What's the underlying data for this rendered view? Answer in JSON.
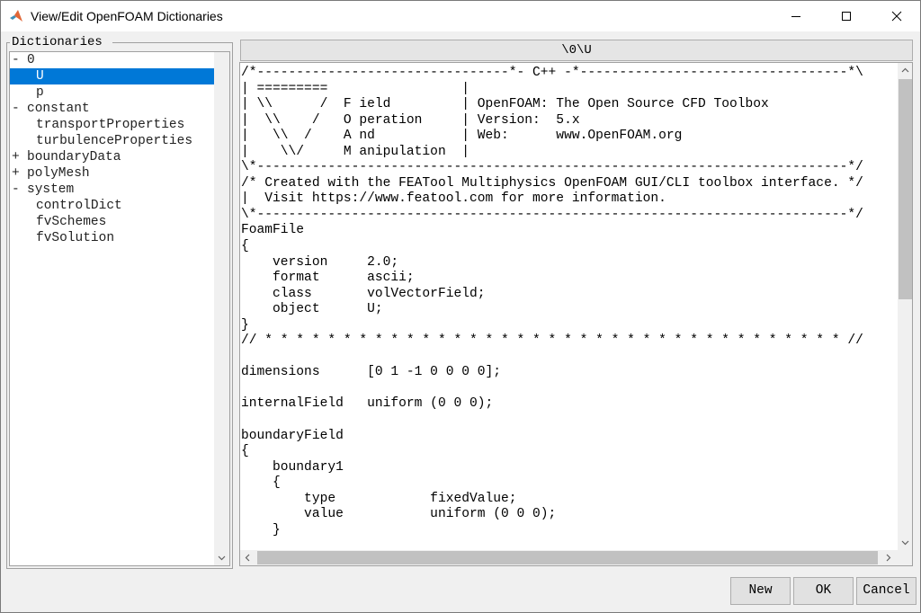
{
  "window": {
    "title": "View/Edit OpenFOAM Dictionaries"
  },
  "dictionaries": {
    "legend": "Dictionaries",
    "tree": [
      {
        "toggle": "-",
        "label": "0",
        "level": 0,
        "selected": false
      },
      {
        "toggle": "",
        "label": "U",
        "level": 1,
        "selected": true
      },
      {
        "toggle": "",
        "label": "p",
        "level": 1,
        "selected": false
      },
      {
        "toggle": "-",
        "label": "constant",
        "level": 0,
        "selected": false
      },
      {
        "toggle": "",
        "label": "transportProperties",
        "level": 1,
        "selected": false
      },
      {
        "toggle": "",
        "label": "turbulenceProperties",
        "level": 1,
        "selected": false
      },
      {
        "toggle": "+",
        "label": "boundaryData",
        "level": 0,
        "selected": false
      },
      {
        "toggle": "+",
        "label": "polyMesh",
        "level": 0,
        "selected": false
      },
      {
        "toggle": "-",
        "label": "system",
        "level": 0,
        "selected": false
      },
      {
        "toggle": "",
        "label": "controlDict",
        "level": 1,
        "selected": false
      },
      {
        "toggle": "",
        "label": "fvSchemes",
        "level": 1,
        "selected": false
      },
      {
        "toggle": "",
        "label": "fvSolution",
        "level": 1,
        "selected": false
      }
    ]
  },
  "editor": {
    "path": "\\0\\U",
    "lines": [
      "/*--------------------------------*- C++ -*----------------------------------*\\",
      "| =========                 |",
      "| \\\\      /  F ield         | OpenFOAM: The Open Source CFD Toolbox",
      "|  \\\\    /   O peration     | Version:  5.x",
      "|   \\\\  /    A nd           | Web:      www.OpenFOAM.org",
      "|    \\\\/     M anipulation  |",
      "\\*---------------------------------------------------------------------------*/",
      "/* Created with the FEATool Multiphysics OpenFOAM GUI/CLI toolbox interface. */",
      "|  Visit https://www.featool.com for more information.",
      "\\*---------------------------------------------------------------------------*/",
      "FoamFile",
      "{",
      "    version     2.0;",
      "    format      ascii;",
      "    class       volVectorField;",
      "    object      U;",
      "}",
      "// * * * * * * * * * * * * * * * * * * * * * * * * * * * * * * * * * * * * * //",
      "",
      "dimensions      [0 1 -1 0 0 0 0];",
      "",
      "internalField   uniform (0 0 0);",
      "",
      "boundaryField",
      "{",
      "    boundary1",
      "    {",
      "        type            fixedValue;",
      "        value           uniform (0 0 0);",
      "    }"
    ]
  },
  "buttons": {
    "new": "New",
    "ok": "OK",
    "cancel": "Cancel"
  },
  "icons": {
    "app": "matlab-icon",
    "minimize": "minimize-icon",
    "maximize": "maximize-icon",
    "close": "close-icon"
  },
  "colors": {
    "selection": "#0078d7",
    "titlebar": "#ffffff",
    "background": "#f0f0f0"
  }
}
